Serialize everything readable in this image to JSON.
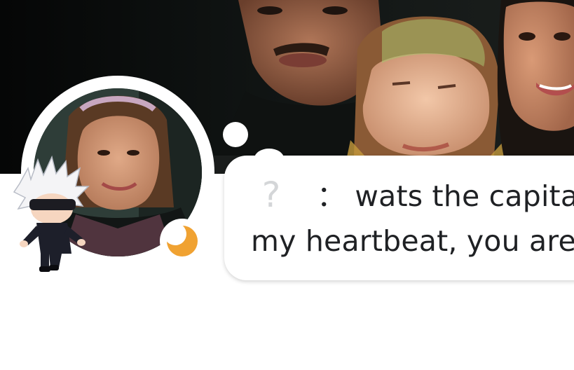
{
  "profile": {
    "custom_status": {
      "emoji": "?",
      "line1": "： wats the capital",
      "line2": "my heartbeat, you are w"
    },
    "status": {
      "icon": "crescent-moon-icon",
      "color": "#f0a232"
    }
  },
  "colors": {
    "banner_bg": "#0b0d0c",
    "bubble_bg": "#ffffff",
    "text": "#1f2124"
  }
}
